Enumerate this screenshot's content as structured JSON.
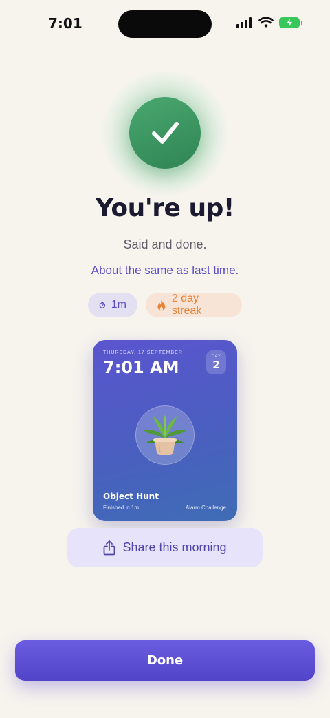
{
  "status_bar": {
    "time": "7:01",
    "icons": [
      "cellular-signal-icon",
      "wifi-icon",
      "battery-charging-icon"
    ]
  },
  "result": {
    "icon": "checkmark-icon",
    "title": "You're up!",
    "subtitle": "Said and done.",
    "comparison": "About the same as last time."
  },
  "stats": {
    "duration": "1m",
    "streak": "2 day streak"
  },
  "card": {
    "date": "THURSDAY, 17 SEPTEMBER",
    "time": "7:01 AM",
    "day_label": "DAY",
    "day_number": "2",
    "image": "potted-plant-icon",
    "challenge_name": "Object Hunt",
    "finished_text": "Finished in 1m",
    "challenge_type": "Alarm Challenge"
  },
  "share": {
    "label": "Share this morning"
  },
  "done": {
    "label": "Done"
  },
  "colors": {
    "background": "#f7f4ee",
    "accent": "#5b4bc9",
    "success": "#3a9460",
    "streak": "#ea8236"
  }
}
